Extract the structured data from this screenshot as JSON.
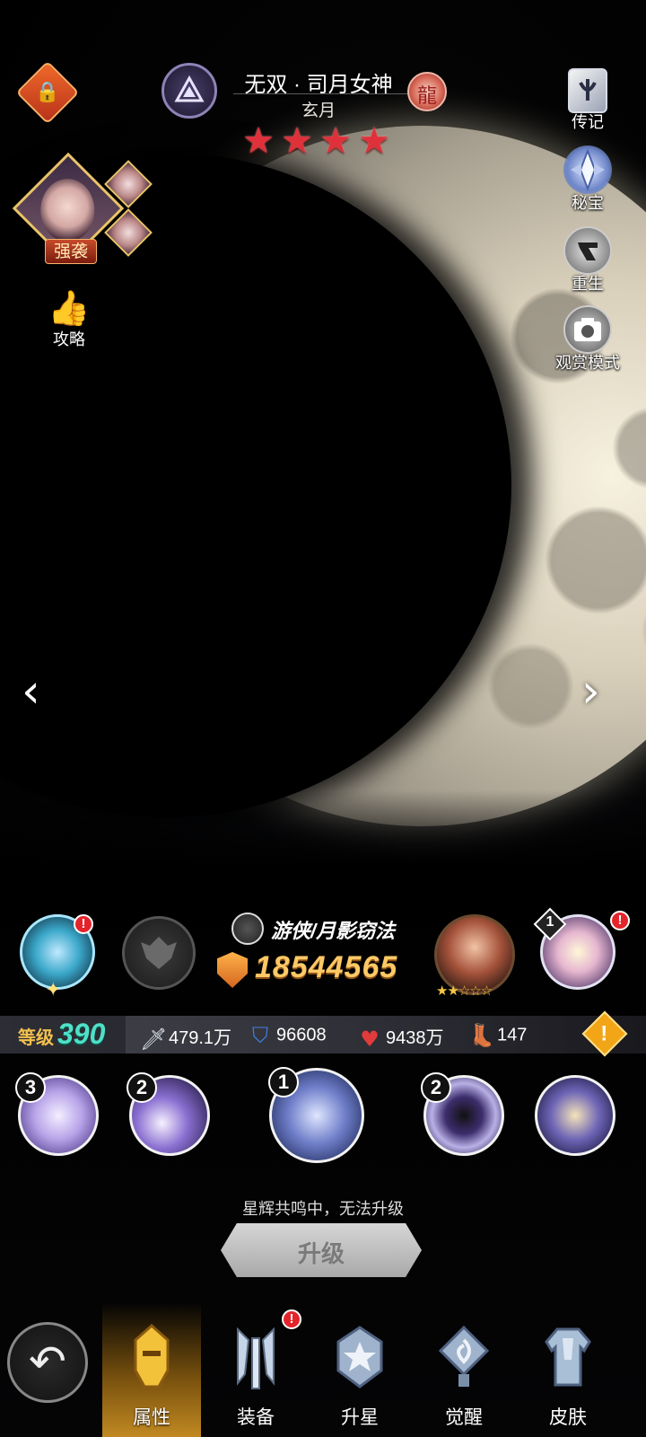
{
  "header": {
    "hero_name": "无双 · 司月女神",
    "hero_title": "玄月",
    "star_count": 4,
    "stars": [
      "★",
      "★",
      "★",
      "★"
    ]
  },
  "left_panel": {
    "strong_badge": "强袭",
    "guide_label": "攻略"
  },
  "right_panel": {
    "items": [
      {
        "label": "传记",
        "icon": "book-icon"
      },
      {
        "label": "秘宝",
        "icon": "treasure-icon"
      },
      {
        "label": "重生",
        "icon": "rebirth-icon"
      },
      {
        "label": "观赏模式",
        "icon": "camera-icon"
      }
    ]
  },
  "hero_info": {
    "role": "游侠/月影窃法",
    "power": "18544565"
  },
  "stats": {
    "level_label": "等级",
    "level": "390",
    "attack": "479.1万",
    "defense": "96608",
    "hp": "9438万",
    "speed": "147"
  },
  "skills": [
    {
      "level": "3",
      "icon": "vortex-skill-icon"
    },
    {
      "level": "2",
      "icon": "moon-phases-skill-icon"
    },
    {
      "level": "1",
      "icon": "moon-shadow-skill-icon"
    },
    {
      "level": "2",
      "icon": "orbit-skill-icon"
    },
    {
      "level": "",
      "icon": "blade-skill-icon"
    }
  ],
  "upgrade": {
    "note": "星辉共鸣中，无法升级",
    "button_label": "升级"
  },
  "badges": {
    "notification": "!",
    "artifact_level": "1"
  },
  "nav": {
    "tabs": [
      {
        "label": "属性",
        "icon": "helmet-icon",
        "active": true
      },
      {
        "label": "装备",
        "icon": "weapons-icon",
        "active": false
      },
      {
        "label": "升星",
        "icon": "star-shield-icon",
        "active": false
      },
      {
        "label": "觉醒",
        "icon": "awaken-icon",
        "active": false
      },
      {
        "label": "皮肤",
        "icon": "armor-icon",
        "active": false
      }
    ]
  },
  "colors": {
    "power_gold": "#ffc966",
    "level_teal": "#4ee0c8",
    "star_red": "#e0303a",
    "active_tab": "#f0aa28"
  }
}
